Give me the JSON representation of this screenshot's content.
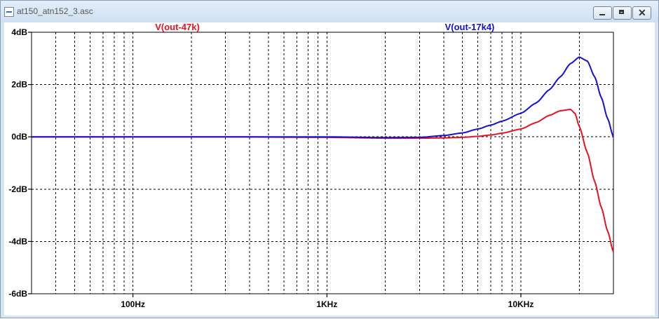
{
  "window": {
    "title": "at150_atn152_3.asc",
    "icons": [
      "app-icon",
      "minimize-icon",
      "restore-icon",
      "close-icon"
    ]
  },
  "colors": {
    "grid": "#000000",
    "axis": "#000000",
    "series1": "#e8121f",
    "series2": "#1010d8"
  },
  "chart_data": {
    "type": "line",
    "title": "",
    "xscale": "log",
    "xlim": [
      30,
      30000
    ],
    "ylim": [
      -6,
      4
    ],
    "yticks": [
      4,
      2,
      0,
      -2,
      -4,
      -6
    ],
    "ytick_labels": [
      "4dB",
      "2dB",
      "0dB",
      "-2dB",
      "-4dB",
      "-6dB"
    ],
    "xticks": [
      100,
      1000,
      10000
    ],
    "xtick_labels": [
      "100Hz",
      "1KHz",
      "10KHz"
    ],
    "grid": true,
    "grid_style": "dashed",
    "series": [
      {
        "name": "V(out-47k)",
        "color": "#e8121f",
        "x": [
          30,
          100,
          200,
          300,
          1000,
          2000,
          3000,
          4000,
          5000,
          6000,
          7000,
          8000,
          10000,
          12000,
          14000,
          16000,
          18000,
          19000,
          20000,
          22000,
          24000,
          26000,
          28000,
          30000
        ],
        "y": [
          0,
          0,
          0,
          0,
          -0.02,
          -0.05,
          -0.05,
          -0.04,
          -0.02,
          0.02,
          0.07,
          0.14,
          0.3,
          0.55,
          0.82,
          1.0,
          1.05,
          0.9,
          0.4,
          -0.6,
          -1.7,
          -2.7,
          -3.6,
          -4.4
        ]
      },
      {
        "name": "V(out-17k4)",
        "color": "#1010d8",
        "x": [
          30,
          100,
          300,
          1000,
          2000,
          3000,
          4000,
          5000,
          6000,
          7000,
          8000,
          10000,
          12000,
          14000,
          16000,
          18000,
          20000,
          22000,
          24000,
          26000,
          28000,
          30000
        ],
        "y": [
          0,
          0,
          0,
          0,
          -0.03,
          -0.02,
          0.05,
          0.15,
          0.3,
          0.45,
          0.6,
          0.9,
          1.3,
          1.8,
          2.3,
          2.8,
          3.05,
          2.9,
          2.3,
          1.5,
          0.7,
          0.0
        ]
      }
    ]
  }
}
